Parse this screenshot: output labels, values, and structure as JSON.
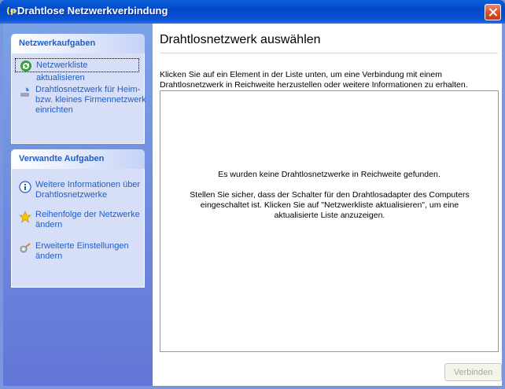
{
  "window": {
    "title": "Drahtlose Netzwerkverbindung",
    "title_icon": "(ᵽ)"
  },
  "sidebar": {
    "panels": [
      {
        "title": "Netzwerkaufgaben",
        "items": [
          {
            "label": "Netzwerkliste aktualisieren",
            "icon": "refresh-icon"
          },
          {
            "label": "Drahtlosnetzwerk für Heim- bzw. kleines Firmennetzwerk einrichten",
            "icon": "wireless-setup-icon"
          }
        ]
      },
      {
        "title": "Verwandte Aufgaben",
        "items": [
          {
            "label": "Weitere Informationen über Drahtlosnetzwerke",
            "icon": "info-icon"
          },
          {
            "label": "Reihenfolge der Netzwerke ändern",
            "icon": "star-icon"
          },
          {
            "label": "Erweiterte Einstellungen ändern",
            "icon": "settings-icon"
          }
        ]
      }
    ]
  },
  "main": {
    "heading": "Drahtlosnetzwerk auswählen",
    "description": "Klicken Sie auf ein Element in der Liste unten, um eine Verbindung mit einem Drahtlosnetzwerk in Reichweite herzustellen oder weitere Informationen zu erhalten.",
    "empty_title": "Es wurden keine Drahtlosnetzwerke in Reichweite gefunden.",
    "empty_hint": "Stellen Sie sicher, dass der Schalter für den Drahtlosadapter des Computers eingeschaltet ist. Klicken Sie auf \"Netzwerkliste aktualisieren\", um eine aktualisierte Liste anzuzeigen.",
    "connect_label": "Verbinden"
  }
}
